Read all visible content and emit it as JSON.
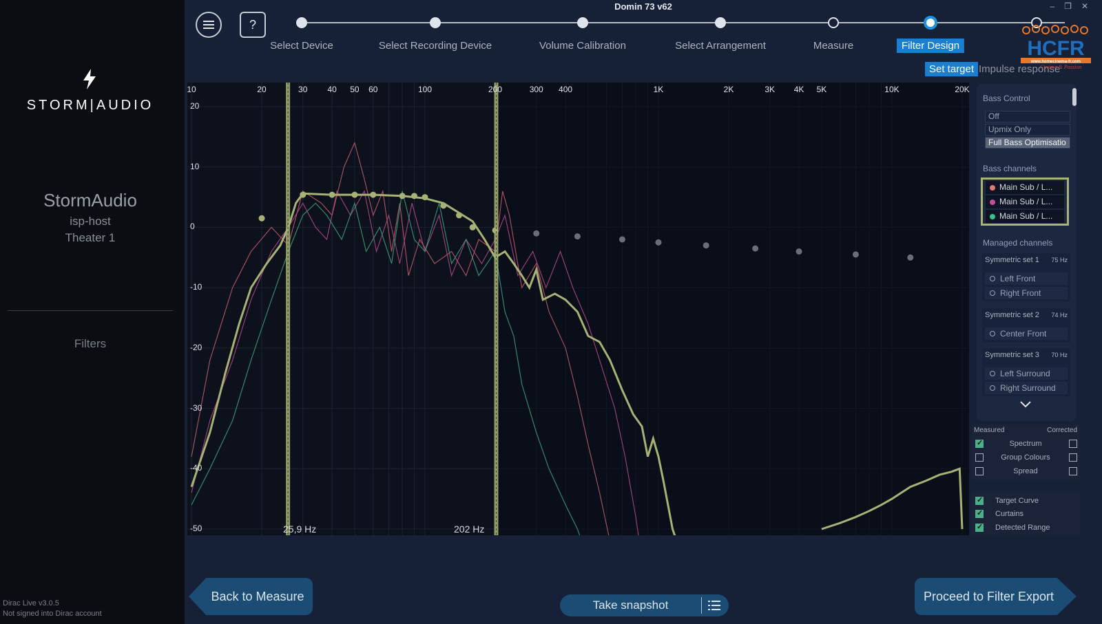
{
  "window": {
    "title": "Domin 73 v62",
    "controls": [
      "–",
      "❐",
      "✕"
    ]
  },
  "sidebar": {
    "brand": "STORM|AUDIO",
    "device_name": "StormAudio",
    "device_host": "isp-host",
    "device_room": "Theater 1",
    "section": "Filters",
    "version_line1": "Dirac Live v3.0.5",
    "version_line2": "Not signed into Dirac account"
  },
  "header": {
    "menu_icon": "menu-icon",
    "help_label": "?"
  },
  "steps": [
    {
      "label": "Select Device",
      "state": "done"
    },
    {
      "label": "Select Recording Device",
      "state": "done"
    },
    {
      "label": "Volume Calibration",
      "state": "done"
    },
    {
      "label": "Select Arrangement",
      "state": "done"
    },
    {
      "label": "Measure",
      "state": "pending"
    },
    {
      "label": "Filter Design",
      "state": "active"
    }
  ],
  "subtabs": {
    "active": "Set target",
    "other": "Impulse response"
  },
  "graph": {
    "x_ticks": [
      "10",
      "20",
      "30",
      "40",
      "50",
      "60",
      "100",
      "200",
      "300",
      "400",
      "1K",
      "2K",
      "3K",
      "4K",
      "5K",
      "10K",
      "20K"
    ],
    "y_ticks": [
      "20",
      "10",
      "0",
      "-10",
      "-20",
      "-30",
      "-40",
      "-50"
    ],
    "curtain_low": "25,9 Hz",
    "curtain_high": "202 Hz",
    "colors": {
      "target": "#a8b276",
      "series1": "#c25a6a",
      "series2": "#b04a86",
      "series3": "#3aa07a"
    }
  },
  "panel": {
    "bass_control_header": "Bass Control",
    "bass_modes": [
      "Off",
      "Upmix Only",
      "Full Bass Optimisatio"
    ],
    "bass_mode_selected": "Full Bass Optimisatio",
    "bass_channels_header": "Bass channels",
    "bass_channels": [
      {
        "label": "Main Sub / L...",
        "color": "#e07a7a"
      },
      {
        "label": "Main Sub / L...",
        "color": "#c0509a"
      },
      {
        "label": "Main Sub / L...",
        "color": "#3abf8a"
      }
    ],
    "managed_header": "Managed channels",
    "sets": [
      {
        "title": "Symmetric set 1",
        "freq": "75 Hz",
        "channels": [
          "Left Front",
          "Right Front"
        ]
      },
      {
        "title": "Symmetric set 2",
        "freq": "74 Hz",
        "channels": [
          "Center Front"
        ]
      },
      {
        "title": "Symmetric set 3",
        "freq": "70 Hz",
        "channels": [
          "Left Surround",
          "Right Surround"
        ]
      }
    ]
  },
  "view_options": {
    "measured_label": "Measured",
    "corrected_label": "Corrected",
    "rows": [
      {
        "label": "Spectrum",
        "measured": true,
        "corrected": false
      },
      {
        "label": "Group Colours",
        "measured": false,
        "corrected": false
      },
      {
        "label": "Spread",
        "measured": false,
        "corrected": false
      }
    ],
    "extras": [
      {
        "label": "Target Curve",
        "checked": true
      },
      {
        "label": "Curtains",
        "checked": true
      },
      {
        "label": "Detected Range",
        "checked": true
      }
    ]
  },
  "footer": {
    "back_label": "Back to Measure",
    "snapshot_label": "Take snapshot",
    "proceed_label": "Proceed to Filter Export"
  },
  "watermark": {
    "text": "HCFR",
    "url": "www.homecinema-fr.com",
    "tagline": "Cinéma & Passion"
  }
}
